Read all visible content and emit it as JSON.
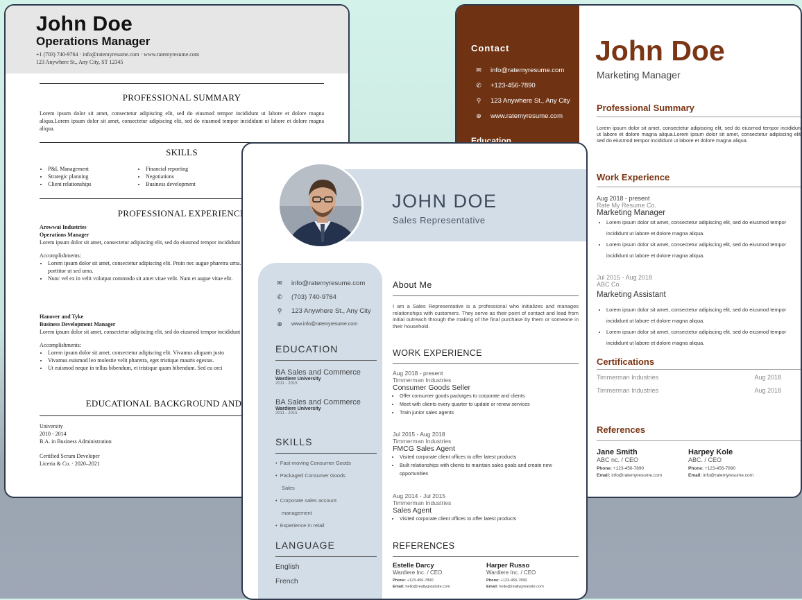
{
  "left_resume": {
    "name": "John Doe",
    "role": "Operations Manager",
    "contact_line": "+1 (703) 740-9764 · info@ratemyresume.com · www.ratemyresume.com",
    "address": "123 Anywhere St., Any City, ST 12345",
    "summary_heading": "PROFESSIONAL SUMMARY",
    "summary_text": "Lorem ipsum dolor sit amet, consectetur adipiscing elit, sed do eiusmod tempor incididunt ut labore et dolore magna aliqua.Lorem ipsum dolor sit amet, consectetur adipiscing elit, sed do eiusmod tempor incididunt ut labore et dolore magna aliqua.",
    "skills_heading": "SKILLS",
    "skills_col1": [
      "P&L Management",
      "Strategic planning",
      "Client relationships"
    ],
    "skills_col2": [
      "Financial reporting",
      "Negotiations",
      "Business development"
    ],
    "experience_heading": "PROFESSIONAL EXPERIENCE",
    "job1_company": "Arowwai Industries",
    "job1_title": "Operations Manager",
    "job1_desc": "Lorem ipsum dolor sit amet, consectetur adipiscing elit, sed do eiusmod tempor incididunt ut labore et dolore magna aliqua.",
    "accomplishments_label": "Accomplishments:",
    "job1_bullets": [
      "Lorem ipsum dolor sit amet, consectetur adipiscing elit. Proin nec augue pharetra urna. Nunc ac odio quis purus fermentum porttitor ut sed urna.",
      "Nunc vel ex in velit volutpat commodo sit amet vitae velit. Nam et augue vitae elit."
    ],
    "job2_company": "Hanover and Tyke",
    "job2_title": "Business Development Manager",
    "job2_desc": "Lorem ipsum dolor sit amet, consectetur adipiscing elit, sed do eiusmod tempor incididunt ut labore et dolore magna aliqua.",
    "job2_bullets": [
      "Lorem ipsum dolor sit amet, consectetur adipiscing elit. Vivamus aliquam justo",
      "Vivamus euismod leo molestie velit pharetra, eget tristique mauris egestas.",
      "Ut euismod neque in tellus bibendum, et tristique quam bibendum. Sed eu orci"
    ],
    "education_heading": "EDUCATIONAL BACKGROUND AND CERTIFI",
    "edu_lines": [
      "University",
      "2010 - 2014",
      "B.A. in Business Administration"
    ],
    "cert_lines": [
      "Certified Scrum Developer",
      "Liceria & Co. · 2020–2021"
    ]
  },
  "right_resume": {
    "contact_heading": "Contact",
    "contacts": [
      {
        "icon": "mail-icon",
        "glyph": "✉",
        "text": "info@ratemyresume.com"
      },
      {
        "icon": "phone-icon",
        "glyph": "✆",
        "text": "+123-456-7890"
      },
      {
        "icon": "location-icon",
        "glyph": "⚲",
        "text": "123 Anywhere St., Any City"
      },
      {
        "icon": "globe-icon",
        "glyph": "⊕",
        "text": "www.ratemyresume.com"
      }
    ],
    "education_heading": "Education",
    "name": "John Doe",
    "role": "Marketing Manager",
    "summary_heading": "Professional Summary",
    "summary_text": "Lorem ipsum dolor sit amet, consectetur adipiscing elit, sed do eiusmod tempor incididunt ut labore et dolore magna aliqua.Lorem ipsum dolor sit amet, consectetur adipiscing elit, sed do eiusmod tempor incididunt ut labore et dolore magna aliqua.",
    "work_heading": "Work Experience",
    "job1_dates": "Aug 2018 - present",
    "job1_company": "Rate My Resume Co.",
    "job1_title": "Marketing Manager",
    "job1_bullets": [
      "Lorem ipsum dolor sit amet, consectetur adipiscing elit, sed do eiusmod tempor incididunt ut labore et dolore magna aliqua.",
      "Lorem ipsum dolor sit amet, consectetur adipiscing elit, sed do eiusmod tempor incididunt ut labore et dolore magna aliqua."
    ],
    "job2_dates": "Jul 2015 - Aug 2018",
    "job2_company": "ABC Co.",
    "job2_title": "Marketing Assistant",
    "job2_bullets": [
      "Lorem ipsum dolor sit amet, consectetur adipiscing elit, sed do eiusmod tempor incididunt ut labore et dolore magna aliqua.",
      "Lorem ipsum dolor sit amet, consectetur adipiscing elit, sed do eiusmod tempor incididunt ut labore et dolore magna aliqua."
    ],
    "cert_heading": "Certifications",
    "certs": [
      {
        "name": "Timmerman Industries",
        "date": "Aug 2018"
      },
      {
        "name": "Timmerman Industries",
        "date": "Aug 2018"
      }
    ],
    "ref_heading": "References",
    "refs": [
      {
        "name": "Jane Smith",
        "company": "ABC nc. / CEO",
        "phone_label": "Phone:",
        "phone": "+123-456-7890",
        "email_label": "Email:",
        "email": "info@ratemyresume.com"
      },
      {
        "name": "Harpey Kole",
        "company": "ABC. / CEO",
        "phone_label": "Phone:",
        "phone": "+123-456-7890",
        "email_label": "Email:",
        "email": "info@ratemyresume.com"
      }
    ]
  },
  "middle_resume": {
    "name": "JOHN DOE",
    "role": "Sales Representative",
    "contacts": [
      {
        "icon": "mail-icon",
        "glyph": "✉",
        "text": "info@ratemyresume.com"
      },
      {
        "icon": "phone-icon",
        "glyph": "✆",
        "text": "(703) 740-9764"
      },
      {
        "icon": "location-icon",
        "glyph": "⚲",
        "text": "123 Anywhere St., Any City"
      },
      {
        "icon": "globe-icon",
        "glyph": "⊕",
        "text": "www.info@ratemyresume.com"
      }
    ],
    "education_heading": "EDUCATION",
    "education": [
      {
        "degree": "BA Sales and Commerce",
        "school": "Wardiere University",
        "years": "2011 - 2015"
      },
      {
        "degree": "BA Sales and Commerce",
        "school": "Wardiere University",
        "years": "2011 - 2015"
      }
    ],
    "skills_heading": "SKILLS",
    "skills": [
      "Fast-moving Consumer Goods",
      "Packaged Consumer Goods",
      "Sales",
      "Corporate sales account",
      "management",
      "Experience in retail"
    ],
    "language_heading": "LANGUAGE",
    "languages": [
      "English",
      "French"
    ],
    "about_heading": "About Me",
    "about_text": "I am a Sales Representative is a professional who initializes and manages relationships with customers. They serve as their point of contact and lead from initial outreach through the making of the final purchase by them or someone in their household.",
    "work_heading": "WORK EXPERIENCE",
    "jobs": [
      {
        "dates": "Aug 2018 - present",
        "company": "Timmerman Industries",
        "title": "Consumer Goods Seller",
        "bullets": [
          "Offer consumer goods packages to corporate and clients",
          "Meet with clients every quarter to update or renew services",
          "Train junior sales agents"
        ]
      },
      {
        "dates": "Jul 2015 - Aug 2018",
        "company": "Timmerman Industries",
        "title": "FMCG Sales Agent",
        "bullets": [
          "Visited corporate client offices to offer latest products",
          "Built relationships with clients to maintain sales goals and create new opportunities"
        ]
      },
      {
        "dates": "Aug 2014 - Jul 2015",
        "company": "Timmerman Industries",
        "title": "Sales Agent",
        "bullets": [
          "Visited corporate client offices to offer latest products"
        ]
      }
    ],
    "ref_heading": "REFERENCES",
    "refs": [
      {
        "name": "Estelle Darcy",
        "company": "Wardiere Inc. / CEO",
        "phone_label": "Phone:",
        "phone": "+123-456-7890",
        "email_label": "Email:",
        "email": "hello@reallygreatsite.com"
      },
      {
        "name": "Harper Russo",
        "company": "Wardiere Inc. / CEO",
        "phone_label": "Phone:",
        "phone": "+123-456-7890",
        "email_label": "Email:",
        "email": "hello@reallygreatsite.com"
      }
    ]
  }
}
